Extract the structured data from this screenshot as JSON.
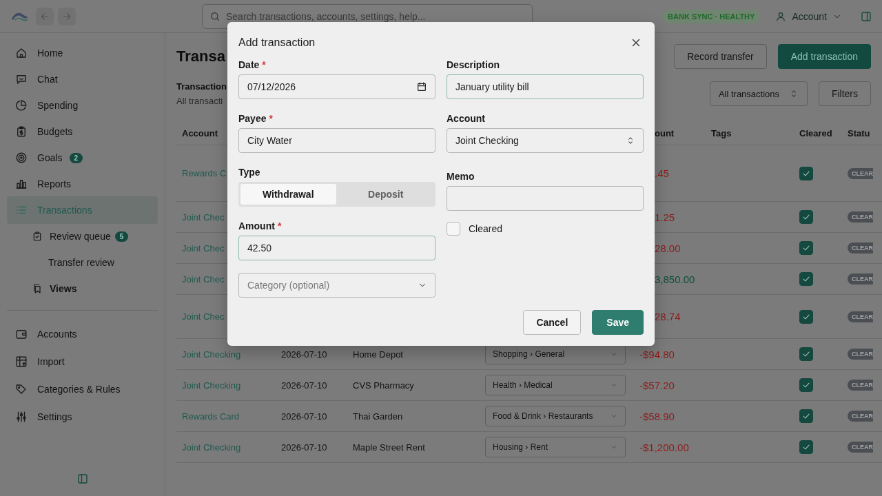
{
  "top_bar": {
    "search": {
      "placeholder": "Search transactions, accounts, settings, help..."
    },
    "sync_badge": "BANK SYNC · HEALTHY",
    "account": "Account"
  },
  "sidebar": {
    "primary": [
      {
        "label": "Home",
        "selected": false
      },
      {
        "label": "Chat",
        "selected": false
      },
      {
        "label": "Spending",
        "selected": false
      },
      {
        "label": "Budgets",
        "selected": false
      },
      {
        "label": "Goals",
        "selected": false,
        "badge": "2"
      },
      {
        "label": "Reports",
        "selected": false
      },
      {
        "label": "Transactions",
        "selected": true,
        "children": [
          {
            "label": "Review queue",
            "kind": "link",
            "badge": "5"
          },
          {
            "label": "Transfer review",
            "kind": "link"
          },
          {
            "label": "Views",
            "kind": "heading"
          }
        ]
      }
    ],
    "secondary": [
      {
        "label": "Accounts",
        "selected": false
      },
      {
        "label": "Import",
        "selected": false
      },
      {
        "label": "Categories & Rules",
        "selected": false
      },
      {
        "label": "Settings",
        "selected": false
      }
    ]
  },
  "page": {
    "title": "Transa",
    "actions": [
      {
        "label": "Record transfer",
        "kind": "secondary"
      },
      {
        "label": "Add transaction",
        "kind": "primary"
      }
    ],
    "filters": {
      "title": "Transaction",
      "summary": "All transacti",
      "view": "All transactions",
      "button": "Filters"
    }
  },
  "table": {
    "columns": [
      {
        "label": "Account",
        "kind": "account"
      },
      {
        "label": "ount",
        "kind": "amount",
        "cut": true
      },
      {
        "label": "Tags",
        "kind": "tags"
      },
      {
        "label": "Cleared",
        "kind": "cleared"
      },
      {
        "label": "Statu",
        "kind": "status"
      }
    ],
    "rows": [
      {
        "kind": "detailed",
        "account": "Rewards C",
        "amount": {
          "text": ".45",
          "kind": "outflow",
          "cut": true
        },
        "cleared": true,
        "status": "CLEAR"
      },
      {
        "kind": "plain",
        "account": "Joint Chec",
        "amount": {
          "text": "1.25",
          "kind": "outflow",
          "cut": true
        },
        "cleared": true,
        "status": "CLEAR"
      },
      {
        "kind": "plain",
        "account": "Joint Chec",
        "amount": {
          "text": "28.00",
          "kind": "outflow",
          "cut": true
        },
        "cleared": true,
        "status": "CLEAR"
      },
      {
        "kind": "plain",
        "account": "Joint Chec",
        "amount": {
          "text": "3,850.00",
          "kind": "inflow",
          "cut": true
        },
        "cleared": true,
        "status": "CLEAR"
      },
      {
        "kind": "detailed",
        "account": "Joint Chec",
        "amount": {
          "text": "28.74",
          "kind": "outflow",
          "cut": true
        },
        "cleared": true,
        "status": "CLEAR"
      },
      {
        "kind": "plain",
        "account": "Joint Checking",
        "date": "2026-07-10",
        "payee": "Home Depot",
        "category": "Shopping › General",
        "amount": {
          "text": "-$94.80",
          "kind": "outflow",
          "cut": false
        },
        "cleared": true,
        "status": "CLEAR"
      },
      {
        "kind": "plain",
        "account": "Joint Checking",
        "date": "2026-07-10",
        "payee": "CVS Pharmacy",
        "category": "Health › Medical",
        "amount": {
          "text": "-$57.20",
          "kind": "outflow",
          "cut": false
        },
        "cleared": true,
        "status": "CLEAR"
      },
      {
        "kind": "plain",
        "account": "Rewards Card",
        "date": "2026-07-10",
        "payee": "Thai Garden",
        "category": "Food & Drink › Restaurants",
        "amount": {
          "text": "-$58.90",
          "kind": "outflow",
          "cut": false
        },
        "cleared": true,
        "status": "CLEAR"
      },
      {
        "kind": "plain",
        "account": "Joint Checking",
        "date": "2026-07-10",
        "payee": "Maple Street Rent",
        "category": "Housing › Rent",
        "amount": {
          "text": "-$1,200.00",
          "kind": "outflow",
          "cut": false
        },
        "cleared": true,
        "status": "CLEAR"
      }
    ]
  },
  "dialog": {
    "title": "Add transaction",
    "required_mark": "*",
    "date": {
      "label": "Date",
      "required": true,
      "value": "07/12/2026",
      "focused": false
    },
    "payee": {
      "label": "Payee",
      "required": true,
      "value": "City Water",
      "focused": false
    },
    "type": {
      "label": "Type",
      "options": [
        {
          "label": "Withdrawal",
          "selected": true
        },
        {
          "label": "Deposit",
          "selected": false
        }
      ]
    },
    "amount": {
      "label": "Amount",
      "required": true,
      "value": "42.50",
      "focused": true
    },
    "category": {
      "placeholder": "Category (optional)"
    },
    "description": {
      "label": "Description",
      "required": false,
      "value": "January utility bill",
      "focused": true
    },
    "account": {
      "label": "Account",
      "required": false,
      "value": "Joint Checking",
      "focused": false
    },
    "memo": {
      "label": "Memo",
      "required": false,
      "focused": false
    },
    "cleared": {
      "label": "Cleared",
      "checked": false
    },
    "buttons": [
      {
        "label": "Cancel",
        "kind": "secondary"
      },
      {
        "label": "Save",
        "kind": "primary"
      }
    ]
  }
}
